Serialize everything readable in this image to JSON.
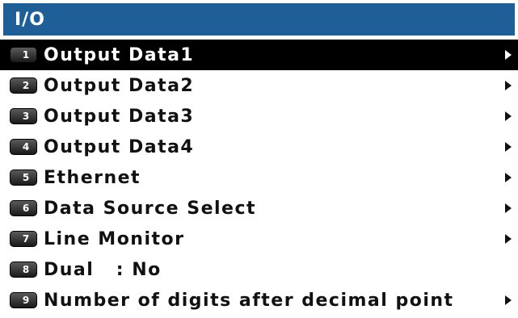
{
  "title": "I/O",
  "menu": {
    "items": [
      {
        "key": "1",
        "label": "Output Data1",
        "has_submenu": true,
        "selected": true
      },
      {
        "key": "2",
        "label": "Output Data2",
        "has_submenu": true,
        "selected": false
      },
      {
        "key": "3",
        "label": "Output Data3",
        "has_submenu": true,
        "selected": false
      },
      {
        "key": "4",
        "label": "Output Data4",
        "has_submenu": true,
        "selected": false
      },
      {
        "key": "5",
        "label": "Ethernet",
        "has_submenu": true,
        "selected": false
      },
      {
        "key": "6",
        "label": "Data Source Select",
        "has_submenu": true,
        "selected": false
      },
      {
        "key": "7",
        "label": "Line Monitor",
        "has_submenu": true,
        "selected": false
      },
      {
        "key": "8",
        "label": "Dual   : No",
        "has_submenu": false,
        "selected": false
      },
      {
        "key": "9",
        "label": "Number of digits after decimal point",
        "has_submenu": true,
        "selected": false
      }
    ]
  },
  "colors": {
    "title_bar": "#1f5f97",
    "selected_row": "#000000"
  },
  "icons": {
    "number_key": "numbered-key-icon",
    "submenu_arrow": "submenu-arrow-icon"
  }
}
